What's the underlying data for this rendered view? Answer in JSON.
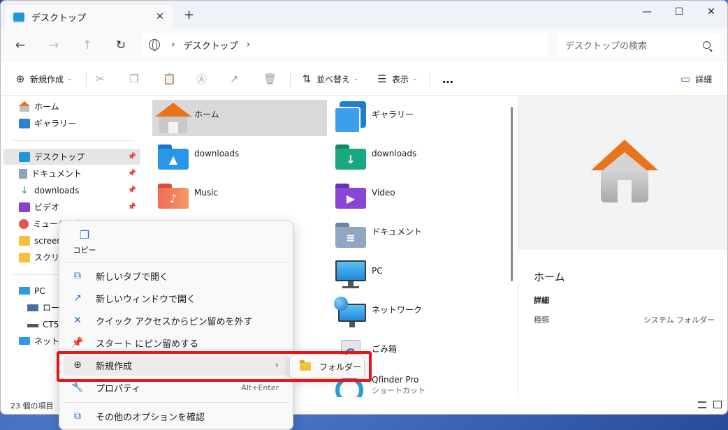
{
  "tab": {
    "title": "デスクトップ",
    "close": "✕",
    "new": "+"
  },
  "window_controls": {
    "minimize": "—",
    "maximize": "☐",
    "close": "✕"
  },
  "nav": {
    "back": "←",
    "forward": "→",
    "up": "↑",
    "refresh": "↻"
  },
  "address": {
    "sep1": "›",
    "crumb": "デスクトップ",
    "sep2": "›"
  },
  "search": {
    "placeholder": "デスクトップの検索"
  },
  "toolbar": {
    "new_label": "新規作成",
    "sort_label": "並べ替え",
    "view_label": "表示",
    "more_label": "…",
    "details_label": "詳細",
    "caret": "⌄"
  },
  "sidebar": {
    "home": "ホーム",
    "gallery": "ギャラリー",
    "desktop": "デスクトップ",
    "documents": "ドキュメント",
    "downloads": "downloads",
    "videos": "ビデオ",
    "music": "ミュージック",
    "screenshots": "screens",
    "screenshots2": "スクリー",
    "pc": "PC",
    "local_disk": "ローカル",
    "ct_drive": "CT512",
    "network": "ネットワ",
    "pin": "📌"
  },
  "items": {
    "home": "ホーム",
    "gallery": "ギャラリー",
    "downloads_a": "downloads",
    "downloads_b": "downloads",
    "music": "Music",
    "video": "Video",
    "documents": "ドキュメント",
    "pc": "PC",
    "network": "ネットワーク",
    "recycle": "ごみ箱",
    "qfinder": "Qfinder Pro",
    "qfinder_sub": "ショートカット"
  },
  "details": {
    "title": "ホーム",
    "section": "詳細",
    "type_key": "種類",
    "type_value": "システム フォルダー"
  },
  "status": {
    "count": "23 個の項目"
  },
  "context_menu": {
    "copy": "コピー",
    "open_tab": "新しいタブで開く",
    "open_window": "新しいウィンドウで開く",
    "unpin_quick": "クイック アクセスからピン留めを外す",
    "pin_start": "スタート にピン留めする",
    "new": "新規作成",
    "new_arrow": "›",
    "properties": "プロパティ",
    "properties_shortcut": "Alt+Enter",
    "more_options": "その他のオプションを確認"
  },
  "submenu": {
    "folder": "フォルダー"
  },
  "colors": {
    "highlight": "#e8141b",
    "accent": "#2b6fb8",
    "folder": "#f4c13f"
  }
}
